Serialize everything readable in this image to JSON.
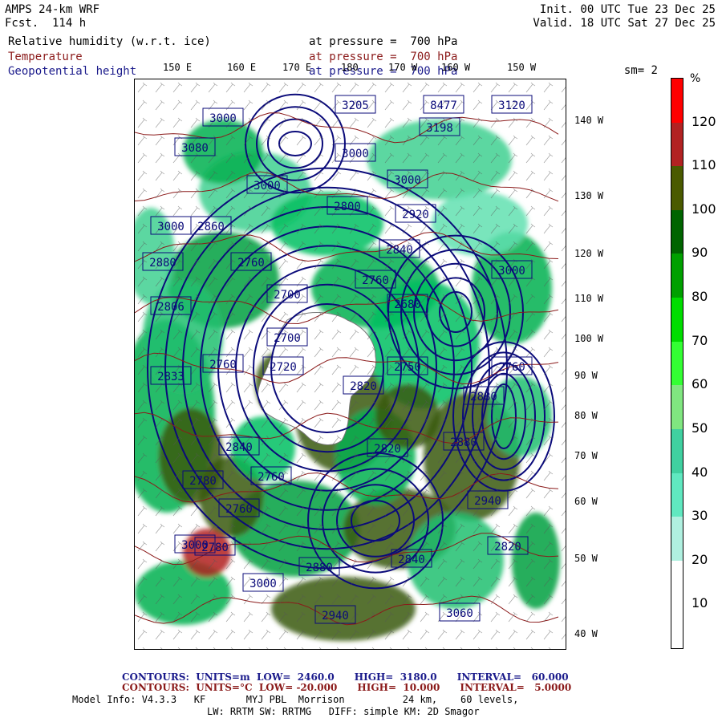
{
  "header": {
    "model": "AMPS 24-km WRF",
    "fcst": "Fcst.  114 h",
    "init": "Init. 00 UTC Tue 23 Dec 25",
    "valid": "Valid. 18 UTC Sat 27 Dec 25"
  },
  "fields": [
    {
      "name": "Relative humidity (w.r.t. ice)",
      "level": "at pressure =  700 hPa",
      "color": "#000000"
    },
    {
      "name": "Temperature",
      "level": "at pressure =  700 hPa",
      "color": "#8b1a1a"
    },
    {
      "name": "Geopotential height",
      "level": "at pressure =  700 hPa",
      "color": "#1a1a8b"
    }
  ],
  "smoothing": "sm= 2",
  "longitude_top_labels": [
    "150 E",
    "160 E",
    "170 E",
    "180",
    "170 W",
    "160 W",
    "150 W"
  ],
  "longitude_right_labels": [
    "140 W",
    "130 W",
    "120 W",
    "110 W",
    "100 W",
    "90 W",
    "80 W",
    "70 W",
    "60 W",
    "50 W",
    "40 W"
  ],
  "colorbar": {
    "unit": "%",
    "labels": [
      "120",
      "110",
      "100",
      "90",
      "80",
      "70",
      "60",
      "50",
      "40",
      "30",
      "20",
      "10"
    ],
    "colors": [
      "#ff0000",
      "#b22222",
      "#4a5a00",
      "#006400",
      "#00a000",
      "#00dd00",
      "#33ff33",
      "#80e680",
      "#40d0a0",
      "#60e8c0",
      "#b0f0e0",
      "#ffffff",
      "#ffffff"
    ]
  },
  "height_labels": [
    "3000",
    "3080",
    "3205",
    "8477",
    "3120",
    "3198",
    "3000",
    "3000",
    "3000",
    "3000",
    "2860",
    "2800",
    "2920",
    "2880",
    "2760",
    "2840",
    "3000",
    "2700",
    "2760",
    "2806",
    "2680",
    "2700",
    "2720",
    "2760",
    "2820",
    "2833",
    "2880",
    "2750",
    "2760",
    "2840",
    "2780",
    "2820",
    "2880",
    "2940",
    "2820",
    "2760",
    "2780",
    "2880",
    "2840",
    "3000",
    "3060",
    "2940",
    "3000",
    "2760"
  ],
  "footer": {
    "contours1": "CONTOURS:  UNITS=m  LOW=  2460.0      HIGH=  3180.0      INTERVAL=   60.000",
    "contours2": "CONTOURS:  UNITS=°C  LOW= -20.000      HIGH=  10.000      INTERVAL=   5.0000",
    "model_info": "Model Info: V4.3.3   KF       MYJ PBL  Morrison          24 km,    60 levels,",
    "physics": "LW: RRTM SW: RRTMG   DIFF: simple KM: 2D Smagor"
  }
}
